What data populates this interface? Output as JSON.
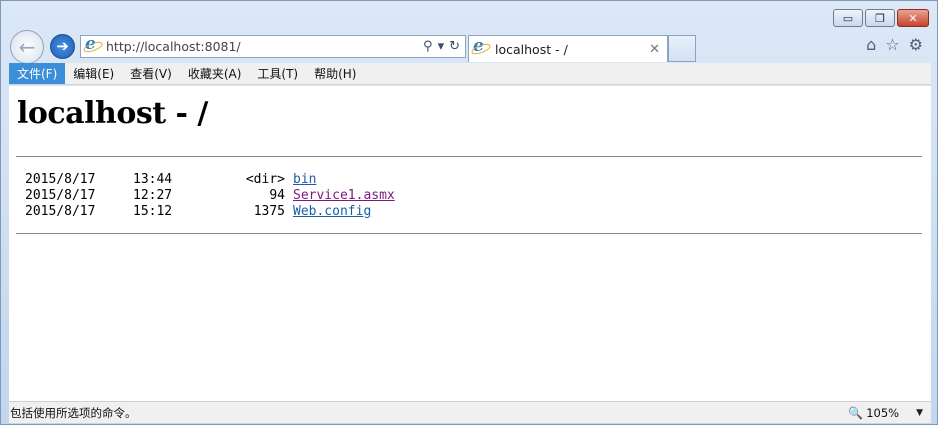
{
  "window": {
    "caption": {
      "minimize": "▭",
      "restore": "❐",
      "close": "✕"
    }
  },
  "nav": {
    "back_glyph": "←",
    "forward_glyph": "➔",
    "address_value": "http://localhost:8081/",
    "address_tools": {
      "search": "⚲",
      "dropdown": "▾",
      "refresh": "↻"
    }
  },
  "tab": {
    "title": "localhost - /",
    "close": "✕"
  },
  "right_icons": {
    "home": "⌂",
    "favorites": "☆",
    "tools": "⚙"
  },
  "menu": {
    "items": [
      {
        "label": "文件(F)"
      },
      {
        "label": "编辑(E)"
      },
      {
        "label": "查看(V)"
      },
      {
        "label": "收藏夹(A)"
      },
      {
        "label": "工具(T)"
      },
      {
        "label": "帮助(H)"
      }
    ]
  },
  "page": {
    "title": "localhost - /",
    "entries": [
      {
        "date": "2015/8/17",
        "time": "13:44",
        "size": "<dir>",
        "name": "bin"
      },
      {
        "date": "2015/8/17",
        "time": "12:27",
        "size": "94",
        "name": "Service1.asmx"
      },
      {
        "date": "2015/8/17",
        "time": "15:12",
        "size": "1375",
        "name": "Web.config"
      }
    ]
  },
  "status": {
    "text": "包括使用所选项的命令。",
    "zoom": "105%",
    "zoom_caret": "▼"
  },
  "colors": {
    "link": "#1a5fa8",
    "visited_link": "#7b1a7b",
    "menu_active": "#3b8fd8"
  }
}
